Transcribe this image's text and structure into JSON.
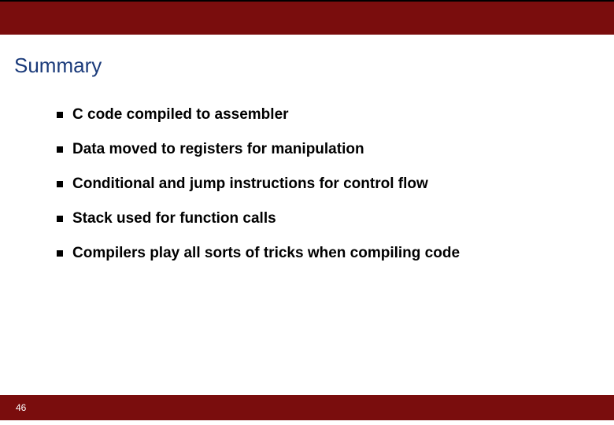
{
  "slide": {
    "title": "Summary",
    "bullets": [
      "C code compiled to assembler",
      "Data moved to registers for manipulation",
      "Conditional and jump instructions for control flow",
      "Stack used for function calls",
      "Compilers play all sorts of tricks when compiling code"
    ],
    "page_number": "46"
  }
}
